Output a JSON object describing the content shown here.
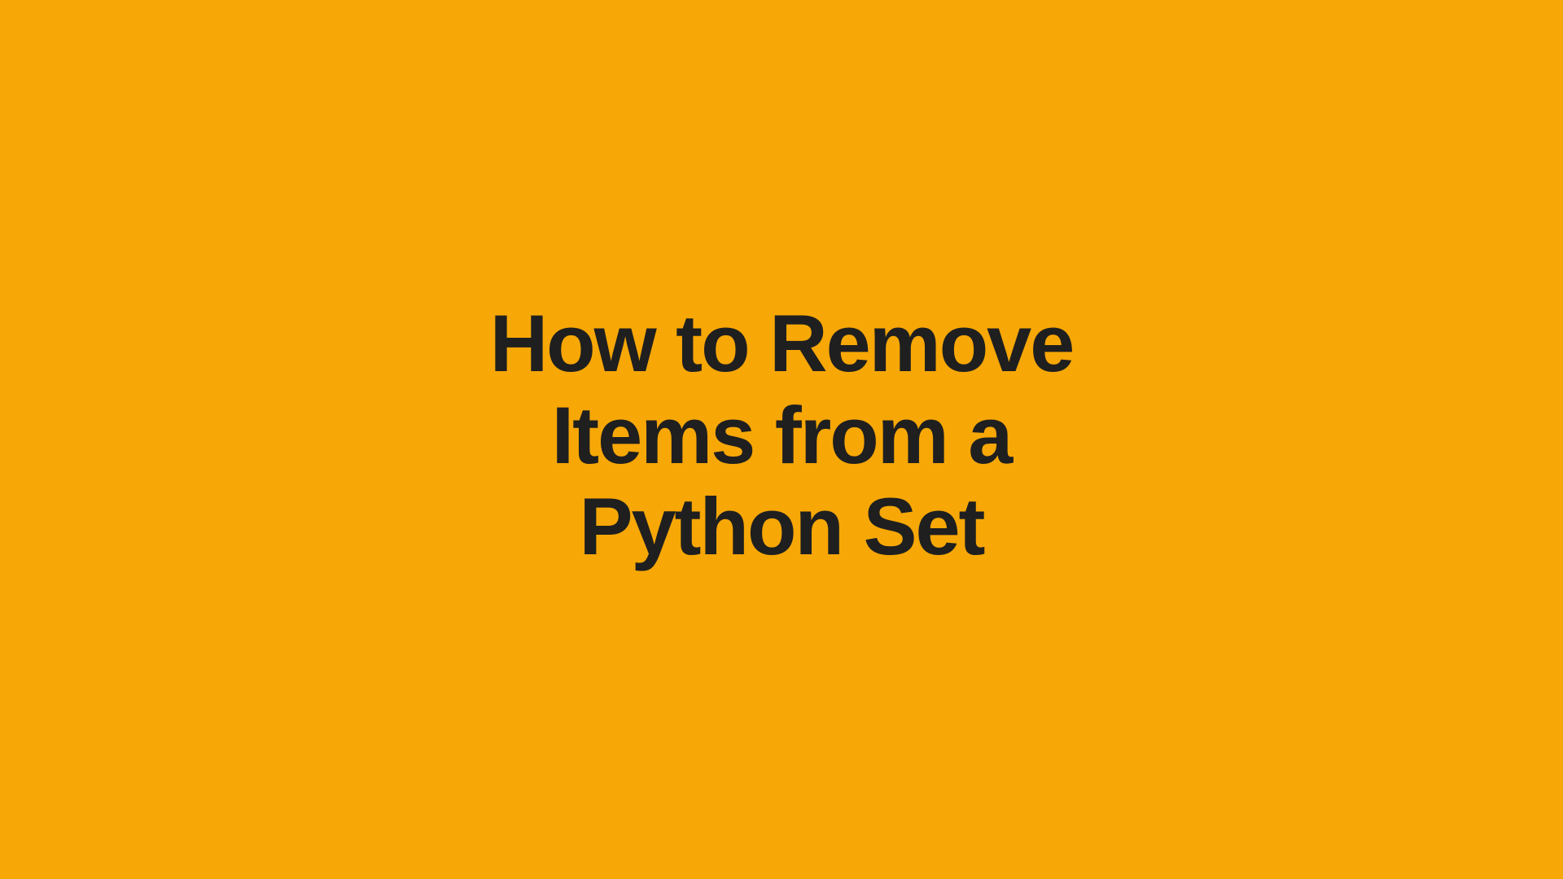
{
  "title": "How to Remove\nItems from a\nPython Set"
}
